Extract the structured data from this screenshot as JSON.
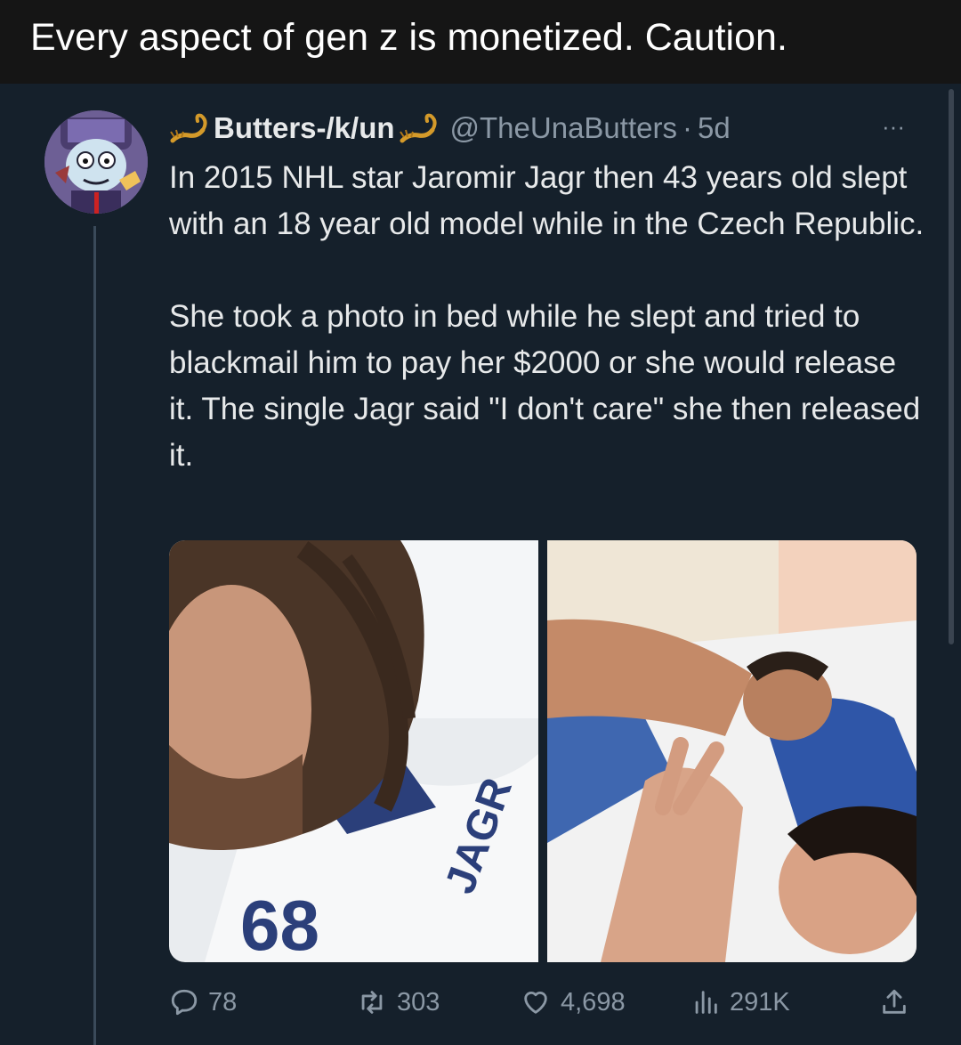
{
  "caption": "Every aspect of gen z is monetized. Caution.",
  "tweet": {
    "display_name": "Butters-/k/un",
    "handle": "@TheUnaButters",
    "separator": "·",
    "time": "5d",
    "more": "···",
    "paragraphs": [
      "In 2015 NHL star Jaromir Jagr then 43 years old slept with an 18 year old model while in the Czech Republic.",
      "She took a photo in bed while he slept and tried to blackmail him to pay her $2000 or she would release it. The single Jagr said \"I don't care\" she then released it."
    ],
    "actions": {
      "replies": "78",
      "retweets": "303",
      "likes": "4,698",
      "views": "291K"
    }
  },
  "colors": {
    "background": "#15202b",
    "caption_bar": "#151515",
    "primary_text": "#e7e9ea",
    "secondary_text": "#8b98a5",
    "accent": "#d49a2a"
  },
  "icons": [
    "scorpion-emoji-icon",
    "more-icon",
    "reply-icon",
    "retweet-icon",
    "like-icon",
    "views-icon",
    "share-icon"
  ]
}
